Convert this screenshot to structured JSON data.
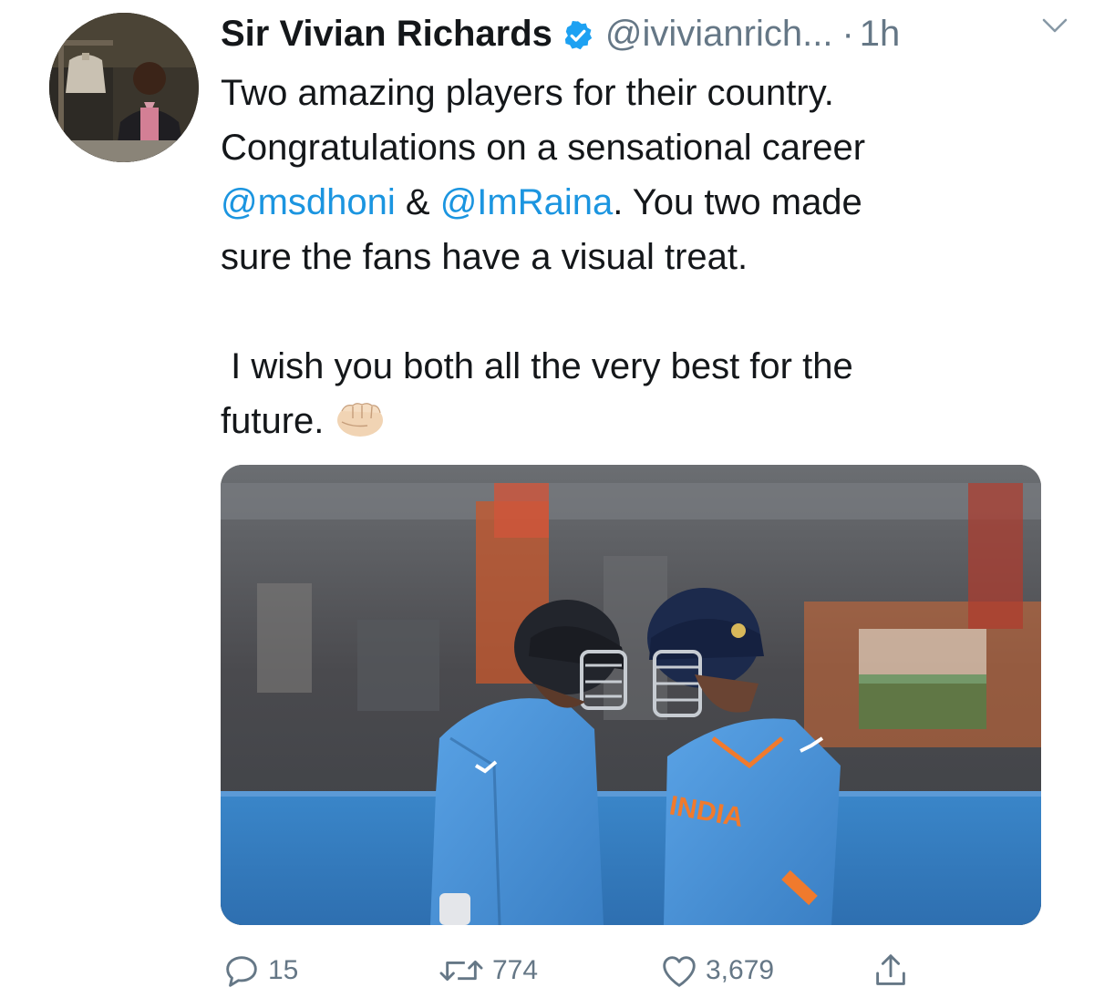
{
  "author": {
    "display_name": "Sir Vivian Richards",
    "verified": true,
    "handle": "@ivivianrich...",
    "separator": "·",
    "time": "1h"
  },
  "tweet": {
    "line1": "Two amazing players for their country.",
    "line2": "Congratulations on a sensational career",
    "mention1": "@msdhoni",
    "ampersand": " & ",
    "mention2": "@ImRaina",
    "line3_rest": ". You two made",
    "line4": "sure the fans have a visual treat.",
    "line5": " I wish you both all the very best for the",
    "line6": "future.",
    "emoji": "fist-bump-emoji"
  },
  "media": {
    "jersey_text": "INDIA"
  },
  "actions": {
    "reply_count": "15",
    "retweet_count": "774",
    "like_count": "3,679"
  },
  "colors": {
    "link": "#1b95e0",
    "secondary_text": "#657786",
    "primary_text": "#14171a",
    "verified_badge": "#1da1f2"
  },
  "icons": [
    "verified-badge-icon",
    "caret-down-icon",
    "reply-icon",
    "retweet-icon",
    "like-icon",
    "share-icon"
  ]
}
